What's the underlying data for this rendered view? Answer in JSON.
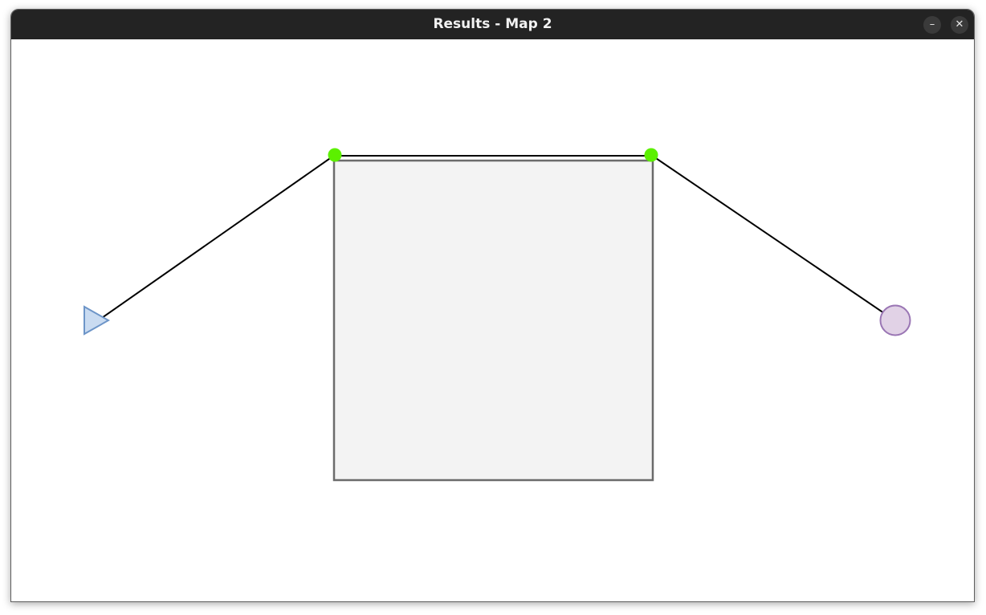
{
  "window": {
    "title": "Results - Map 2",
    "minimize_icon": "minimize-icon",
    "close_icon": "close-icon",
    "minimize_glyph": "–",
    "close_glyph": "✕"
  },
  "map": {
    "obstacle_fill": "#f3f3f3",
    "obstacle_stroke": "#6b6b6b",
    "path_color": "#000000",
    "waypoint_color": "#5cf000",
    "start_marker": {
      "shape": "triangle",
      "fill": "#c9dbf1",
      "stroke": "#6d95c8"
    },
    "goal_marker": {
      "shape": "circle",
      "fill": "#e1d2e6",
      "stroke": "#9a76b4"
    }
  }
}
